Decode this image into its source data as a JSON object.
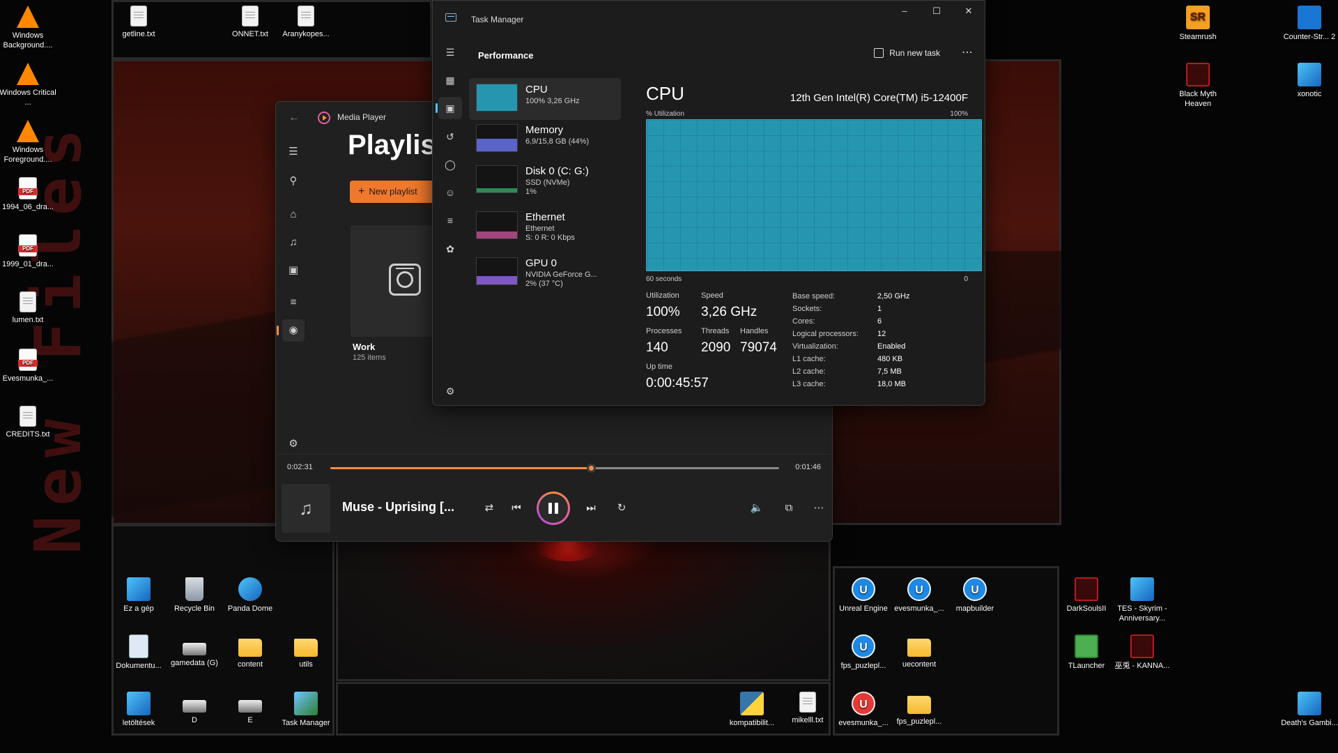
{
  "desktop": {
    "wallpaper_text": "New Files",
    "icons": {
      "win_bg": "Windows Background....",
      "win_crit": "Windows Critical ...",
      "win_fg": "Windows Foreground....",
      "pdf1994": "1994_06_dra...",
      "pdf1999": "1999_01_dra...",
      "lumen": "lumen.txt",
      "evesmunka_pdf": "Evesmunka_...",
      "credits": "CREDITS.txt",
      "getline": "getline.txt",
      "onnet": "ONNET.txt",
      "aranykopes": "Aranykopes...",
      "steamrush": "Steamrush",
      "counter": "Counter-Str... 2",
      "blackmyth": "Black Myth Heaven",
      "xonotic": "xonotic",
      "ez_a_gep": "Ez a gép",
      "recycle": "Recycle Bin",
      "panda": "Panda Dome",
      "dokumentu": "Dokumentu...",
      "gamedata": "gamedata (G)",
      "content": "content",
      "utils": "utils",
      "letoltesek": "letöltések",
      "d": "D",
      "e": "E",
      "taskmanager": "Task Manager",
      "kompatibilit": "kompatibilit...",
      "mikelll": "mikelll.txt",
      "unreal": "Unreal Engine",
      "evesmunka_ue": "evesmunka_...",
      "mapbuilder": "mapbuilder",
      "fps1": "fps_puzlepl...",
      "uecontent": "uecontent",
      "evesmunka_red": "evesmunka_...",
      "fps2": "fps_puzlepl...",
      "darksouls": "DarkSoulsII",
      "skyrim": "TES - Skyrim - Anniversary...",
      "tlauncher": "TLauncher",
      "kanna": "巫兎 - KANNA...",
      "deaths": "Death's Gambi..."
    }
  },
  "media_player": {
    "title": "Media Player",
    "heading": "Playlist",
    "new_playlist": "New playlist",
    "playlist_name": "Work",
    "playlist_count": "125 items",
    "time_elapsed": "0:02:31",
    "time_remaining": "0:01:46",
    "progress": 0.58,
    "song_title": "Muse - Uprising [...",
    "accent": "#ff8c42"
  },
  "task_manager": {
    "title": "Task Manager",
    "page": "Performance",
    "run_new_task": "Run new task",
    "devices": [
      {
        "name": "CPU",
        "line1": "100%  3,26 GHz",
        "line2": ""
      },
      {
        "name": "Memory",
        "line1": "6,9/15,8 GB (44%)",
        "line2": ""
      },
      {
        "name": "Disk 0 (C: G:)",
        "line1": "SSD (NVMe)",
        "line2": "1%"
      },
      {
        "name": "Ethernet",
        "line1": "Ethernet",
        "line2": "S: 0 R: 0 Kbps"
      },
      {
        "name": "GPU 0",
        "line1": "NVIDIA GeForce G...",
        "line2": "2% (37 °C)"
      }
    ],
    "detail": {
      "heading": "CPU",
      "model": "12th Gen Intel(R) Core(TM) i5-12400F",
      "y_label": "% Utilization",
      "y_max": "100%",
      "x_label": "60 seconds",
      "x_end": "0",
      "utilization_level": 1.0,
      "utilization_label": "Utilization",
      "utilization": "100%",
      "speed_label": "Speed",
      "speed": "3,26 GHz",
      "processes_label": "Processes",
      "processes": "140",
      "threads_label": "Threads",
      "threads": "2090",
      "handles_label": "Handles",
      "handles": "79074",
      "uptime_label": "Up time",
      "uptime": "0:00:45:57",
      "specs": [
        {
          "k": "Base speed:",
          "v": "2,50 GHz"
        },
        {
          "k": "Sockets:",
          "v": "1"
        },
        {
          "k": "Cores:",
          "v": "6"
        },
        {
          "k": "Logical processors:",
          "v": "12"
        },
        {
          "k": "Virtualization:",
          "v": "Enabled"
        },
        {
          "k": "L1 cache:",
          "v": "480 KB"
        },
        {
          "k": "L2 cache:",
          "v": "7,5 MB"
        },
        {
          "k": "L3 cache:",
          "v": "18,0 MB"
        }
      ]
    },
    "accent": "#2596b0"
  }
}
